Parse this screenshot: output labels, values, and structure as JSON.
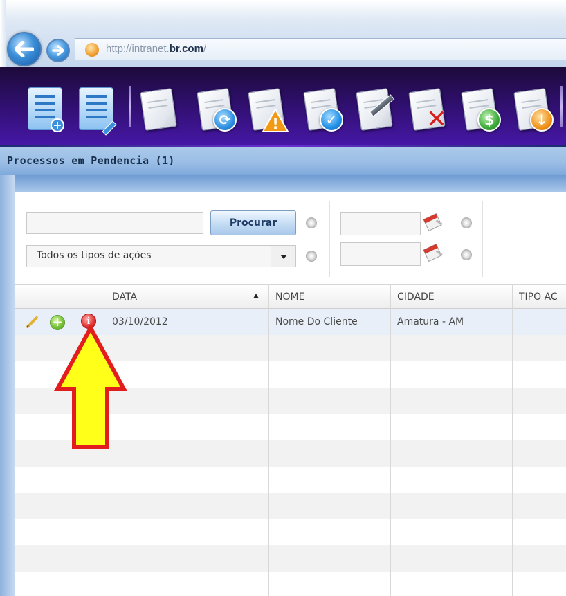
{
  "browser": {
    "url_prefix": "http://intranet.",
    "url_domain": "br.com",
    "url_suffix": "/"
  },
  "toolbar": {
    "buttons": [
      {
        "name": "new-list",
        "icon": "document-list-add-icon"
      },
      {
        "name": "edit-list",
        "icon": "document-list-edit-icon"
      },
      {
        "name": "document",
        "icon": "document-icon"
      },
      {
        "name": "refresh",
        "icon": "document-refresh-icon",
        "color": "#2f8fe0"
      },
      {
        "name": "warning",
        "icon": "document-warning-icon",
        "color": "#f09a1a"
      },
      {
        "name": "approve",
        "icon": "document-check-icon",
        "color": "#1f8fe6"
      },
      {
        "name": "edit",
        "icon": "document-pencil-icon"
      },
      {
        "name": "delete",
        "icon": "document-x-icon",
        "color": "#d62020"
      },
      {
        "name": "payment",
        "icon": "document-dollar-icon",
        "color": "#3caa3a"
      },
      {
        "name": "download",
        "icon": "document-download-icon",
        "color": "#f0921a"
      }
    ]
  },
  "section": {
    "title": "Processos  em Pendencia   (1)"
  },
  "filters": {
    "search_value": "",
    "search_button": "Procurar",
    "action_type_selected": "Todos os tipos de ações",
    "date_from": "",
    "date_to": ""
  },
  "grid": {
    "columns": [
      "DATA",
      "NOME",
      "CIDADE",
      "TIPO AC"
    ],
    "sorted_column": "DATA",
    "sort_direction": "ascending",
    "rows": [
      {
        "data": "03/10/2012",
        "nome": "Nome Do Cliente",
        "cidade": "Amatura - AM",
        "tipo": ""
      }
    ]
  },
  "colors": {
    "toolbar_bg": "#2e0f6b",
    "header_bg": "#9cbfe6",
    "annotation_arrow_fill": "#ffff1a",
    "annotation_arrow_stroke": "#e21d1d"
  }
}
